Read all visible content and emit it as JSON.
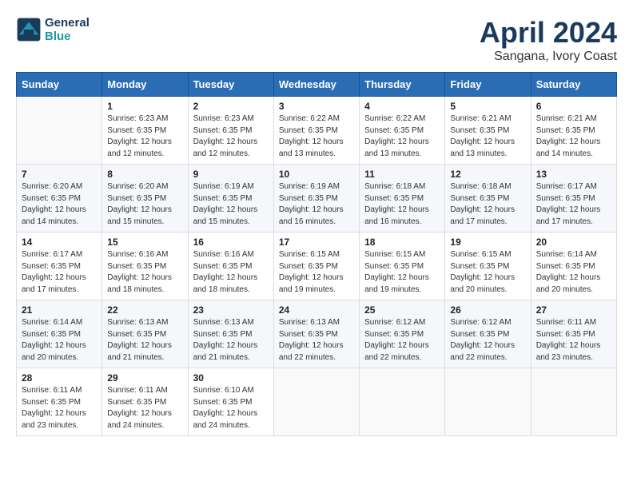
{
  "header": {
    "logo_line1": "General",
    "logo_line2": "Blue",
    "month": "April 2024",
    "location": "Sangana, Ivory Coast"
  },
  "weekdays": [
    "Sunday",
    "Monday",
    "Tuesday",
    "Wednesday",
    "Thursday",
    "Friday",
    "Saturday"
  ],
  "weeks": [
    [
      {
        "day": "",
        "info": ""
      },
      {
        "day": "1",
        "info": "Sunrise: 6:23 AM\nSunset: 6:35 PM\nDaylight: 12 hours\nand 12 minutes."
      },
      {
        "day": "2",
        "info": "Sunrise: 6:23 AM\nSunset: 6:35 PM\nDaylight: 12 hours\nand 12 minutes."
      },
      {
        "day": "3",
        "info": "Sunrise: 6:22 AM\nSunset: 6:35 PM\nDaylight: 12 hours\nand 13 minutes."
      },
      {
        "day": "4",
        "info": "Sunrise: 6:22 AM\nSunset: 6:35 PM\nDaylight: 12 hours\nand 13 minutes."
      },
      {
        "day": "5",
        "info": "Sunrise: 6:21 AM\nSunset: 6:35 PM\nDaylight: 12 hours\nand 13 minutes."
      },
      {
        "day": "6",
        "info": "Sunrise: 6:21 AM\nSunset: 6:35 PM\nDaylight: 12 hours\nand 14 minutes."
      }
    ],
    [
      {
        "day": "7",
        "info": "Sunrise: 6:20 AM\nSunset: 6:35 PM\nDaylight: 12 hours\nand 14 minutes."
      },
      {
        "day": "8",
        "info": "Sunrise: 6:20 AM\nSunset: 6:35 PM\nDaylight: 12 hours\nand 15 minutes."
      },
      {
        "day": "9",
        "info": "Sunrise: 6:19 AM\nSunset: 6:35 PM\nDaylight: 12 hours\nand 15 minutes."
      },
      {
        "day": "10",
        "info": "Sunrise: 6:19 AM\nSunset: 6:35 PM\nDaylight: 12 hours\nand 16 minutes."
      },
      {
        "day": "11",
        "info": "Sunrise: 6:18 AM\nSunset: 6:35 PM\nDaylight: 12 hours\nand 16 minutes."
      },
      {
        "day": "12",
        "info": "Sunrise: 6:18 AM\nSunset: 6:35 PM\nDaylight: 12 hours\nand 17 minutes."
      },
      {
        "day": "13",
        "info": "Sunrise: 6:17 AM\nSunset: 6:35 PM\nDaylight: 12 hours\nand 17 minutes."
      }
    ],
    [
      {
        "day": "14",
        "info": "Sunrise: 6:17 AM\nSunset: 6:35 PM\nDaylight: 12 hours\nand 17 minutes."
      },
      {
        "day": "15",
        "info": "Sunrise: 6:16 AM\nSunset: 6:35 PM\nDaylight: 12 hours\nand 18 minutes."
      },
      {
        "day": "16",
        "info": "Sunrise: 6:16 AM\nSunset: 6:35 PM\nDaylight: 12 hours\nand 18 minutes."
      },
      {
        "day": "17",
        "info": "Sunrise: 6:15 AM\nSunset: 6:35 PM\nDaylight: 12 hours\nand 19 minutes."
      },
      {
        "day": "18",
        "info": "Sunrise: 6:15 AM\nSunset: 6:35 PM\nDaylight: 12 hours\nand 19 minutes."
      },
      {
        "day": "19",
        "info": "Sunrise: 6:15 AM\nSunset: 6:35 PM\nDaylight: 12 hours\nand 20 minutes."
      },
      {
        "day": "20",
        "info": "Sunrise: 6:14 AM\nSunset: 6:35 PM\nDaylight: 12 hours\nand 20 minutes."
      }
    ],
    [
      {
        "day": "21",
        "info": "Sunrise: 6:14 AM\nSunset: 6:35 PM\nDaylight: 12 hours\nand 20 minutes."
      },
      {
        "day": "22",
        "info": "Sunrise: 6:13 AM\nSunset: 6:35 PM\nDaylight: 12 hours\nand 21 minutes."
      },
      {
        "day": "23",
        "info": "Sunrise: 6:13 AM\nSunset: 6:35 PM\nDaylight: 12 hours\nand 21 minutes."
      },
      {
        "day": "24",
        "info": "Sunrise: 6:13 AM\nSunset: 6:35 PM\nDaylight: 12 hours\nand 22 minutes."
      },
      {
        "day": "25",
        "info": "Sunrise: 6:12 AM\nSunset: 6:35 PM\nDaylight: 12 hours\nand 22 minutes."
      },
      {
        "day": "26",
        "info": "Sunrise: 6:12 AM\nSunset: 6:35 PM\nDaylight: 12 hours\nand 22 minutes."
      },
      {
        "day": "27",
        "info": "Sunrise: 6:11 AM\nSunset: 6:35 PM\nDaylight: 12 hours\nand 23 minutes."
      }
    ],
    [
      {
        "day": "28",
        "info": "Sunrise: 6:11 AM\nSunset: 6:35 PM\nDaylight: 12 hours\nand 23 minutes."
      },
      {
        "day": "29",
        "info": "Sunrise: 6:11 AM\nSunset: 6:35 PM\nDaylight: 12 hours\nand 24 minutes."
      },
      {
        "day": "30",
        "info": "Sunrise: 6:10 AM\nSunset: 6:35 PM\nDaylight: 12 hours\nand 24 minutes."
      },
      {
        "day": "",
        "info": ""
      },
      {
        "day": "",
        "info": ""
      },
      {
        "day": "",
        "info": ""
      },
      {
        "day": "",
        "info": ""
      }
    ]
  ]
}
